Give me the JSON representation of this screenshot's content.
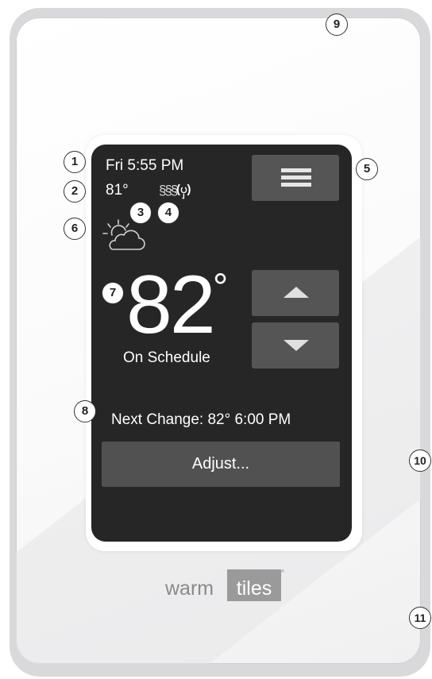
{
  "screen": {
    "date_time": "Fri 5:55 PM",
    "floor_temp": "81°",
    "heating_icon": "heating-wave-icon",
    "wifi_icon": "wifi-signal-icon",
    "weather_icon": "partly-cloudy-icon",
    "menu_icon": "hamburger-menu-icon",
    "set_temp": "82",
    "set_temp_unit": "°",
    "status": "On Schedule",
    "up_icon": "arrow-up-icon",
    "down_icon": "arrow-down-icon",
    "next_change": "Next Change: 82°  6:00 PM",
    "adjust_label": "Adjust..."
  },
  "brand": {
    "logo_part1": "warm",
    "logo_part2": "tiles"
  },
  "callouts": [
    "1",
    "2",
    "3",
    "4",
    "5",
    "6",
    "7",
    "8",
    "9",
    "10",
    "11"
  ],
  "colors": {
    "screen_bg": "#262626",
    "button_bg": "#555555",
    "frame": "#d9d9db"
  }
}
